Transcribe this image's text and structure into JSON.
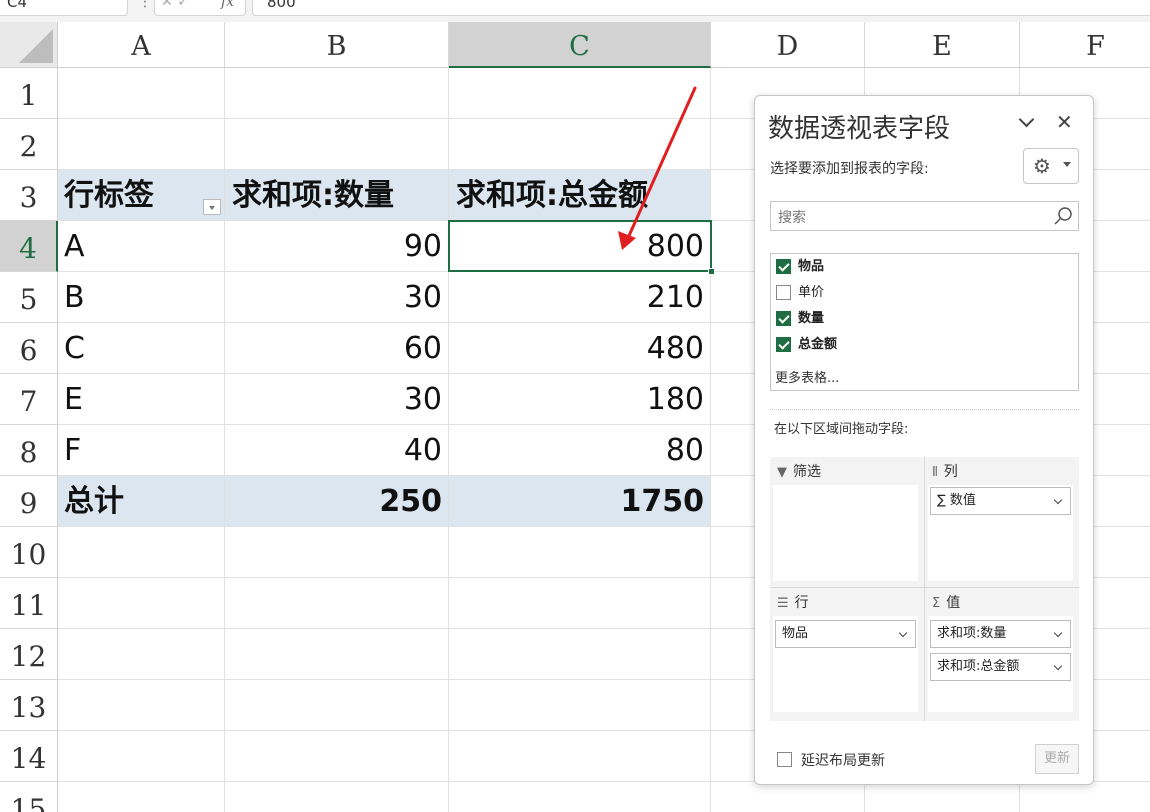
{
  "formula_bar": {
    "name_box": "C4",
    "dots": "⋮",
    "cancel": "✕",
    "confirm": "✓",
    "fx": "fx",
    "formula": "800"
  },
  "columns": [
    "A",
    "B",
    "C",
    "D",
    "E",
    "F"
  ],
  "rows": [
    "1",
    "2",
    "3",
    "4",
    "5",
    "6",
    "7",
    "8",
    "9",
    "10",
    "11",
    "12",
    "13",
    "14",
    "15"
  ],
  "pivot": {
    "header": {
      "label": "行标签",
      "sum_qty": "求和项:数量",
      "sum_amount": "求和项:总金额"
    },
    "items": [
      {
        "label": "A",
        "qty": "90",
        "amount": "800"
      },
      {
        "label": "B",
        "qty": "30",
        "amount": "210"
      },
      {
        "label": "C",
        "qty": "60",
        "amount": "480"
      },
      {
        "label": "E",
        "qty": "30",
        "amount": "180"
      },
      {
        "label": "F",
        "qty": "40",
        "amount": "80"
      }
    ],
    "total": {
      "label": "总计",
      "qty": "250",
      "amount": "1750"
    }
  },
  "panel": {
    "title": "数据透视表字段",
    "subtitle": "选择要添加到报表的字段:",
    "search_placeholder": "搜索",
    "fields": [
      {
        "label": "物品",
        "checked": true
      },
      {
        "label": "单价",
        "checked": false
      },
      {
        "label": "数量",
        "checked": true
      },
      {
        "label": "总金额",
        "checked": true
      }
    ],
    "more_tables": "更多表格...",
    "drag_label": "在以下区域间拖动字段:",
    "areas": {
      "filter": {
        "label": "筛选",
        "icon": "filter-icon"
      },
      "columns": {
        "label": "列",
        "icon": "columns-icon",
        "items": [
          "∑ 数值"
        ]
      },
      "rows": {
        "label": "行",
        "icon": "rows-icon",
        "items": [
          "物品"
        ]
      },
      "values": {
        "label": "值",
        "icon": "sigma-icon",
        "items": [
          "求和项:数量",
          "求和项:总金额"
        ]
      }
    },
    "defer_label": "延迟布局更新",
    "update_label": "更新"
  },
  "colors": {
    "accent": "#1f6e43",
    "pivot_band": "#dce6f1",
    "arrow": "#e02020"
  }
}
